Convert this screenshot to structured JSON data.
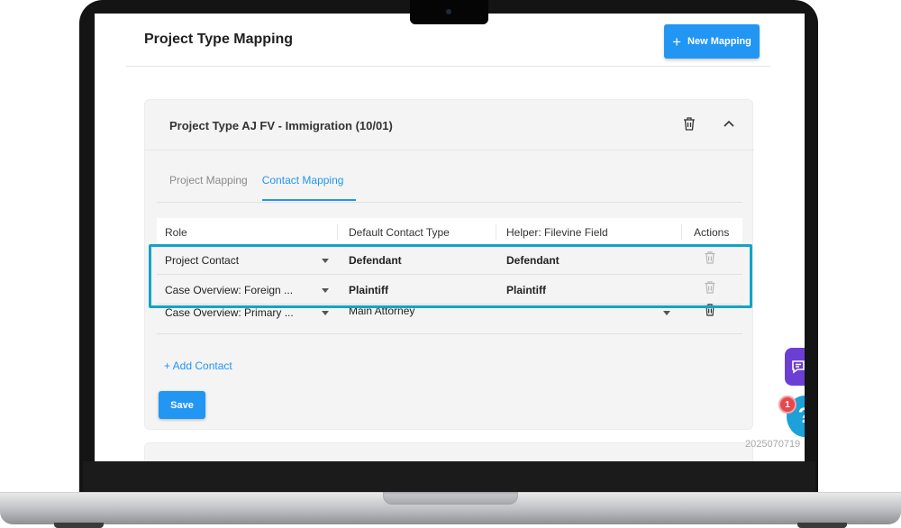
{
  "header": {
    "title": "Project Type Mapping",
    "new_mapping_label": "New Mapping",
    "new_mapping_icon": "+"
  },
  "card": {
    "title": "Project Type AJ FV - Immigration (10/01)",
    "icons": [
      "trash-icon",
      "chevron-up-icon"
    ],
    "tabs": [
      {
        "label": "Project Mapping",
        "active": false
      },
      {
        "label": "Contact Mapping",
        "active": true
      }
    ],
    "table": {
      "columns": [
        "Role",
        "Default Contact Type",
        "Helper: Filevine Field",
        "Actions"
      ],
      "rows": [
        {
          "role": "Project Contact",
          "contact_type": "Defendant",
          "helper": "Defendant"
        },
        {
          "role": "Case Overview: Foreign ...",
          "contact_type": "Plaintiff",
          "helper": "Plaintiff"
        },
        {
          "role": "Case Overview: Primary ...",
          "contact_type": "Main Attorney",
          "helper": ""
        }
      ]
    },
    "add_contact_label": "+ Add Contact",
    "save_label": "Save"
  },
  "widgets": {
    "help_badge_count": "1",
    "help_label": "?",
    "timestamp": "2025070719"
  },
  "colors": {
    "accent": "#2196f3",
    "highlight": "#14a3c7",
    "chat_widget": "#6b3fd4",
    "help_widget": "#1ea0d8",
    "badge": "#e5484d"
  }
}
